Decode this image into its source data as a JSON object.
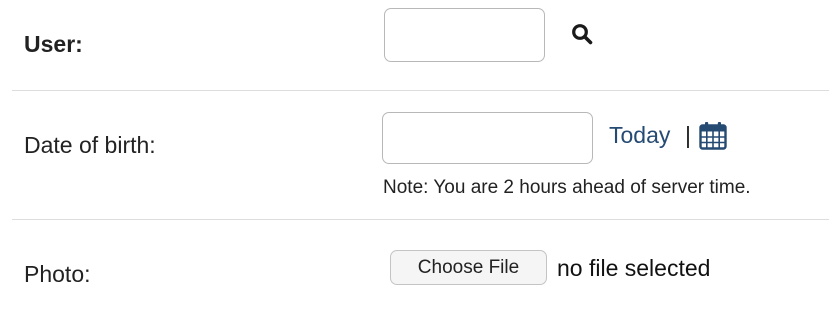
{
  "user": {
    "label": "User:",
    "input_value": "",
    "lookup_icon": "search-icon"
  },
  "dob": {
    "label": "Date of birth:",
    "input_value": "",
    "today_link": "Today",
    "separator": "|",
    "calendar_icon": "calendar-icon",
    "note": "Note: You are 2 hours ahead of server time."
  },
  "photo": {
    "label": "Photo:",
    "choose_button": "Choose File",
    "file_status": "no file selected"
  },
  "colors": {
    "link": "#264b73",
    "divider": "#dddddd",
    "input_border": "#b8b8b8"
  }
}
